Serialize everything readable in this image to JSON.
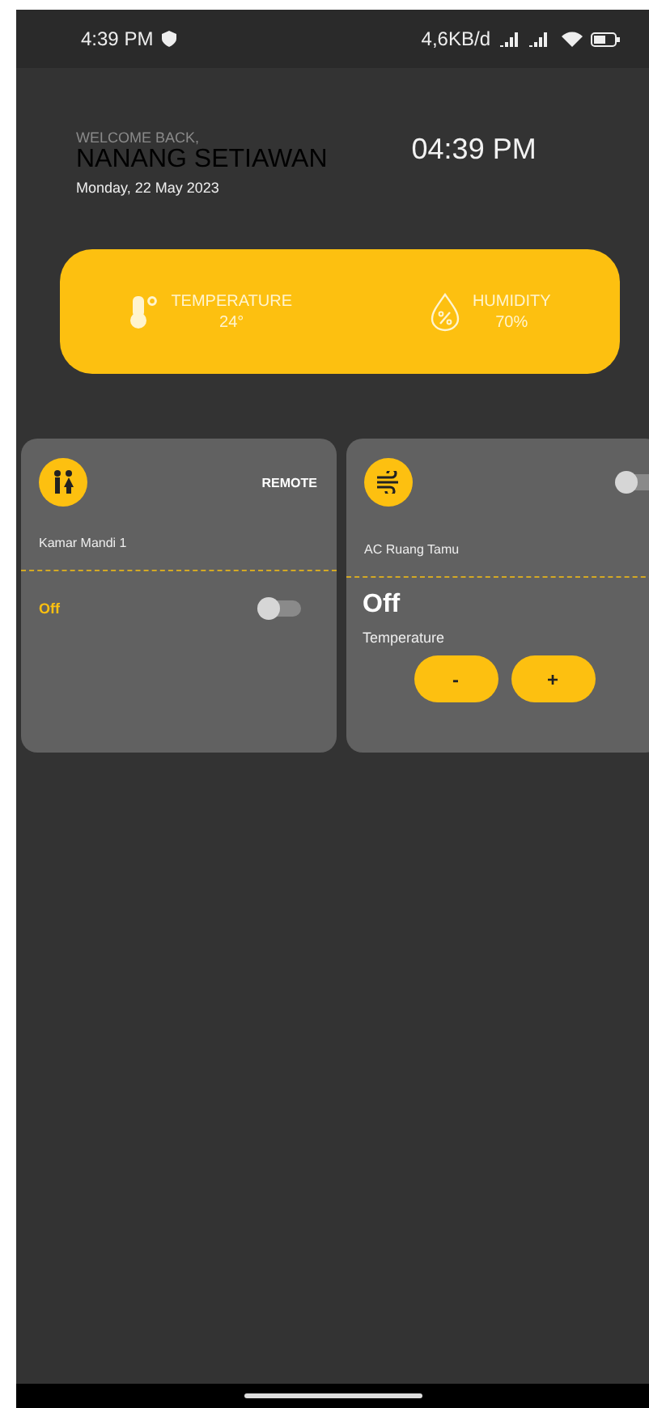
{
  "status_bar": {
    "time": "4:39 PM",
    "network_speed": "4,6KB/d"
  },
  "greeting": {
    "welcome": "WELCOME BACK,",
    "name": "NANANG SETIAWAN",
    "date": "Monday, 22 May 2023",
    "clock": "04:39 PM"
  },
  "climate": [
    {
      "kind": "temperature",
      "label": "TEMPERATURE",
      "value": "24°"
    },
    {
      "kind": "humidity",
      "label": "HUMIDITY",
      "value": "70%"
    }
  ],
  "devices": [
    {
      "kind": "bathroom",
      "name": "Kamar Mandi 1",
      "action": "REMOTE",
      "status": "Off",
      "on": false
    },
    {
      "kind": "ac",
      "name": "AC Ruang Tamu",
      "status": "Off",
      "on": false,
      "temperature_label": "Temperature",
      "buttons": [
        "-",
        "+"
      ]
    }
  ]
}
